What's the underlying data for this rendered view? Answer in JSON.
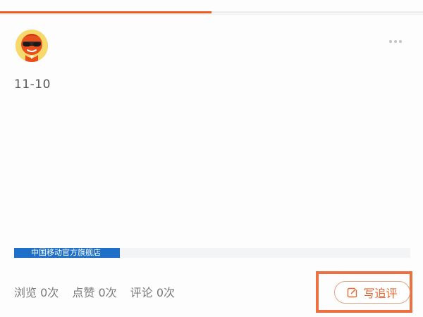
{
  "header": {
    "progress_percent": 50
  },
  "author": {
    "avatar_icon": "sunglasses-mascot-avatar"
  },
  "post": {
    "date": "11-10"
  },
  "store": {
    "name": "中国移动官方旗舰店"
  },
  "stats": {
    "views": "浏览 0次",
    "likes": "点赞 0次",
    "comments": "评论 0次"
  },
  "actions": {
    "write_followup_label": "写追评",
    "write_icon": "edit-icon",
    "more_icon": "more-dots-icon"
  },
  "colors": {
    "accent": "#ef5a1e",
    "button_text": "#e6672f",
    "store_tag": "#1e6fc7",
    "highlight": "#ed7140"
  }
}
